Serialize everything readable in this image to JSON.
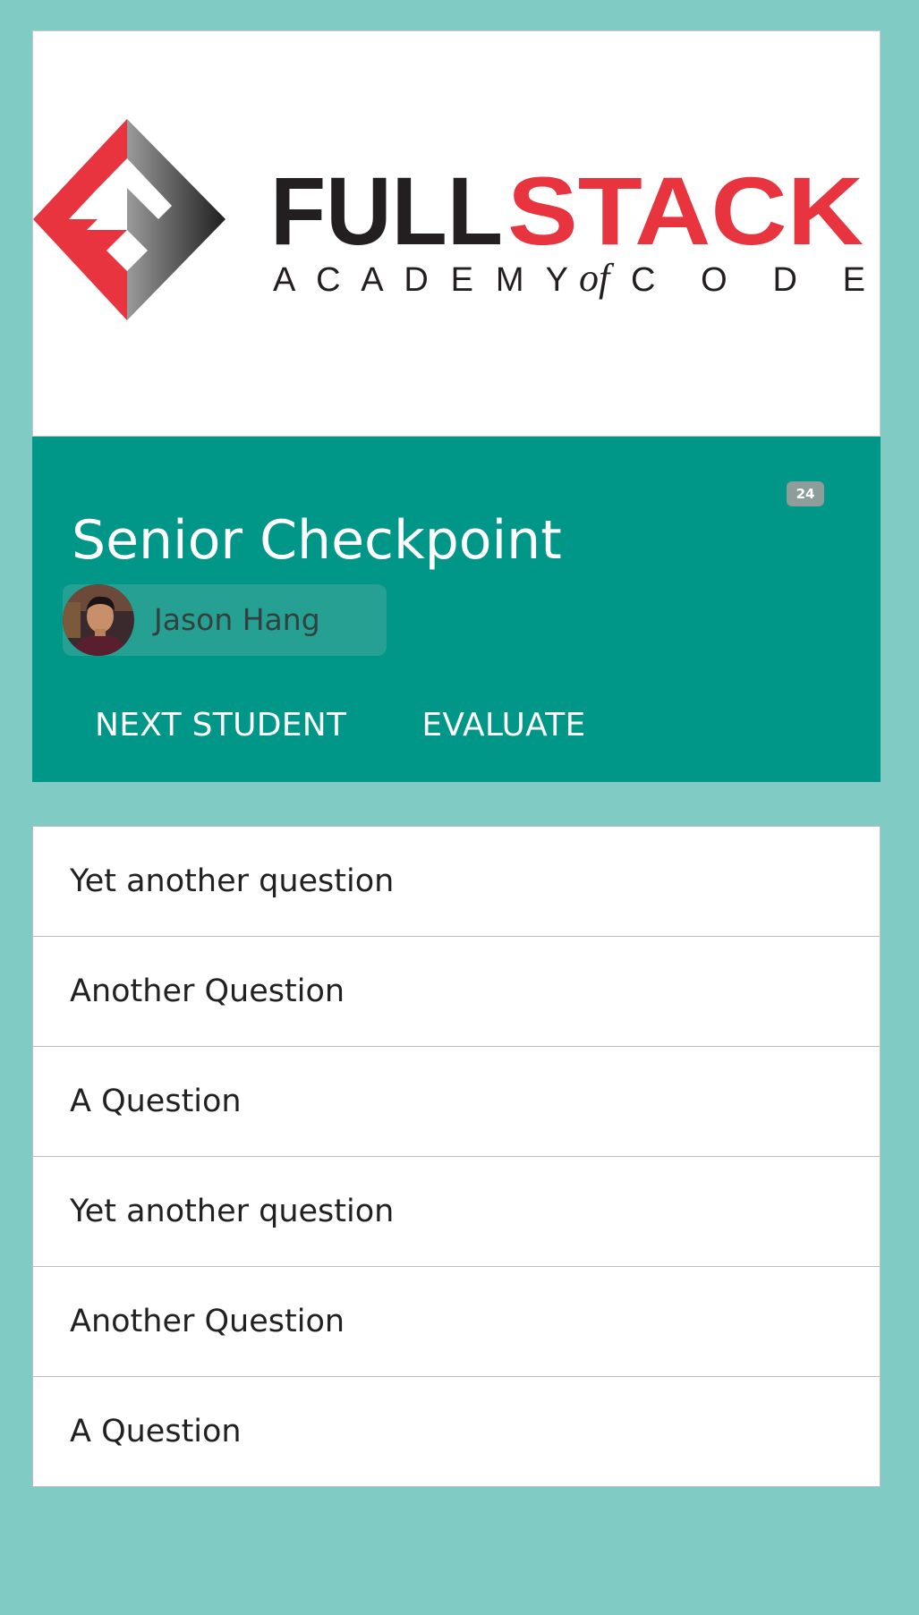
{
  "brand": {
    "logo_word_primary": "FULL",
    "logo_word_accent": "STACK",
    "logo_tagline_left": "A C A D E M Y",
    "logo_tagline_mid": "of",
    "logo_tagline_right": "C O D E",
    "primary_color": "#009688",
    "accent_color": "#e8343f",
    "dark_color": "#231f20"
  },
  "header": {
    "title": "Senior Checkpoint",
    "badge_count": "24",
    "student": {
      "name": "Jason Hang",
      "avatar_icon": "student-avatar"
    },
    "actions": {
      "next_label": "NEXT STUDENT",
      "evaluate_label": "EVALUATE"
    }
  },
  "questions": [
    {
      "label": "Yet another question"
    },
    {
      "label": "Another Question"
    },
    {
      "label": "A Question"
    },
    {
      "label": "Yet another question"
    },
    {
      "label": "Another Question"
    },
    {
      "label": "A Question"
    }
  ]
}
